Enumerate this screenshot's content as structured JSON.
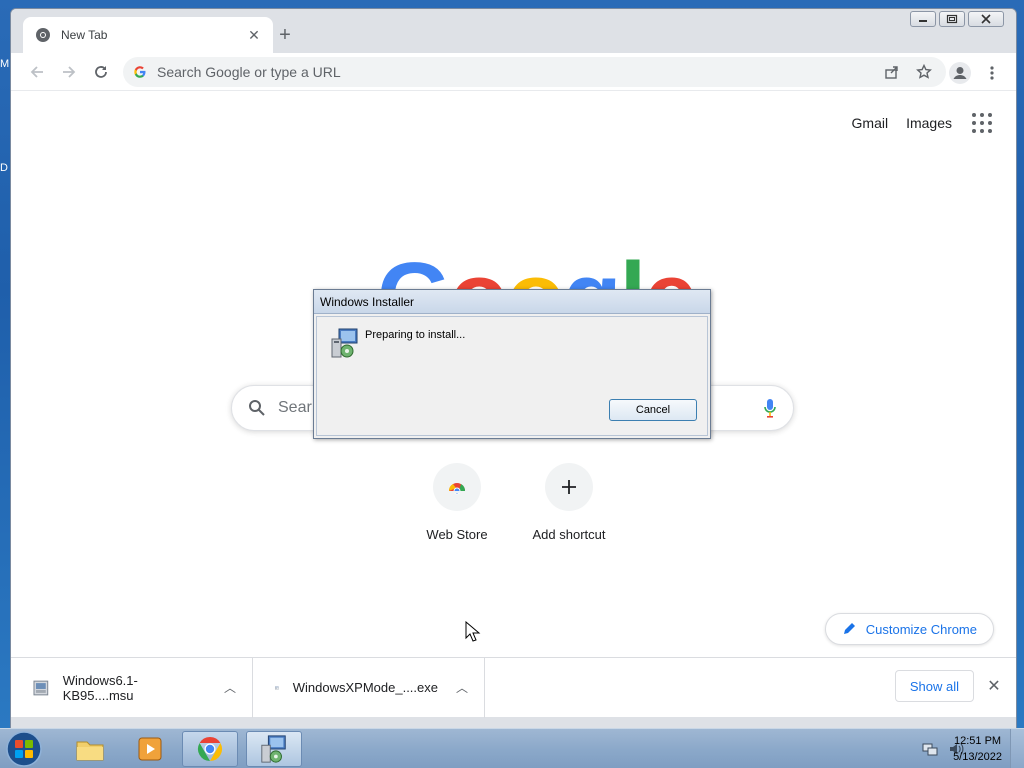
{
  "browser": {
    "tab": {
      "title": "New Tab",
      "close": "✕"
    },
    "new_tab": "+",
    "omnibox": {
      "placeholder": "Search Google or type a URL"
    }
  },
  "page": {
    "top_links": [
      "Gmail",
      "Images"
    ],
    "logo": [
      "G",
      "o",
      "o",
      "g",
      "l",
      "e"
    ],
    "logo_colors": [
      "#4285f4",
      "#ea4335",
      "#fbbc05",
      "#4285f4",
      "#34a853",
      "#ea4335"
    ],
    "search_placeholder": "Sear",
    "shortcuts": [
      {
        "label": "Web Store",
        "icon": "webstore-icon"
      },
      {
        "label": "Add shortcut",
        "icon": "plus-icon"
      }
    ],
    "customize": "Customize Chrome"
  },
  "downloads": {
    "items": [
      {
        "name": "Windows6.1-KB95....msu"
      },
      {
        "name": "WindowsXPMode_....exe"
      }
    ],
    "show_all": "Show all"
  },
  "dialog": {
    "title": "Windows Installer",
    "message": "Preparing to install...",
    "cancel": "Cancel"
  },
  "taskbar": {
    "time": "12:51 PM",
    "date": "5/13/2022"
  },
  "desktop_fragments": [
    "M",
    "D"
  ]
}
